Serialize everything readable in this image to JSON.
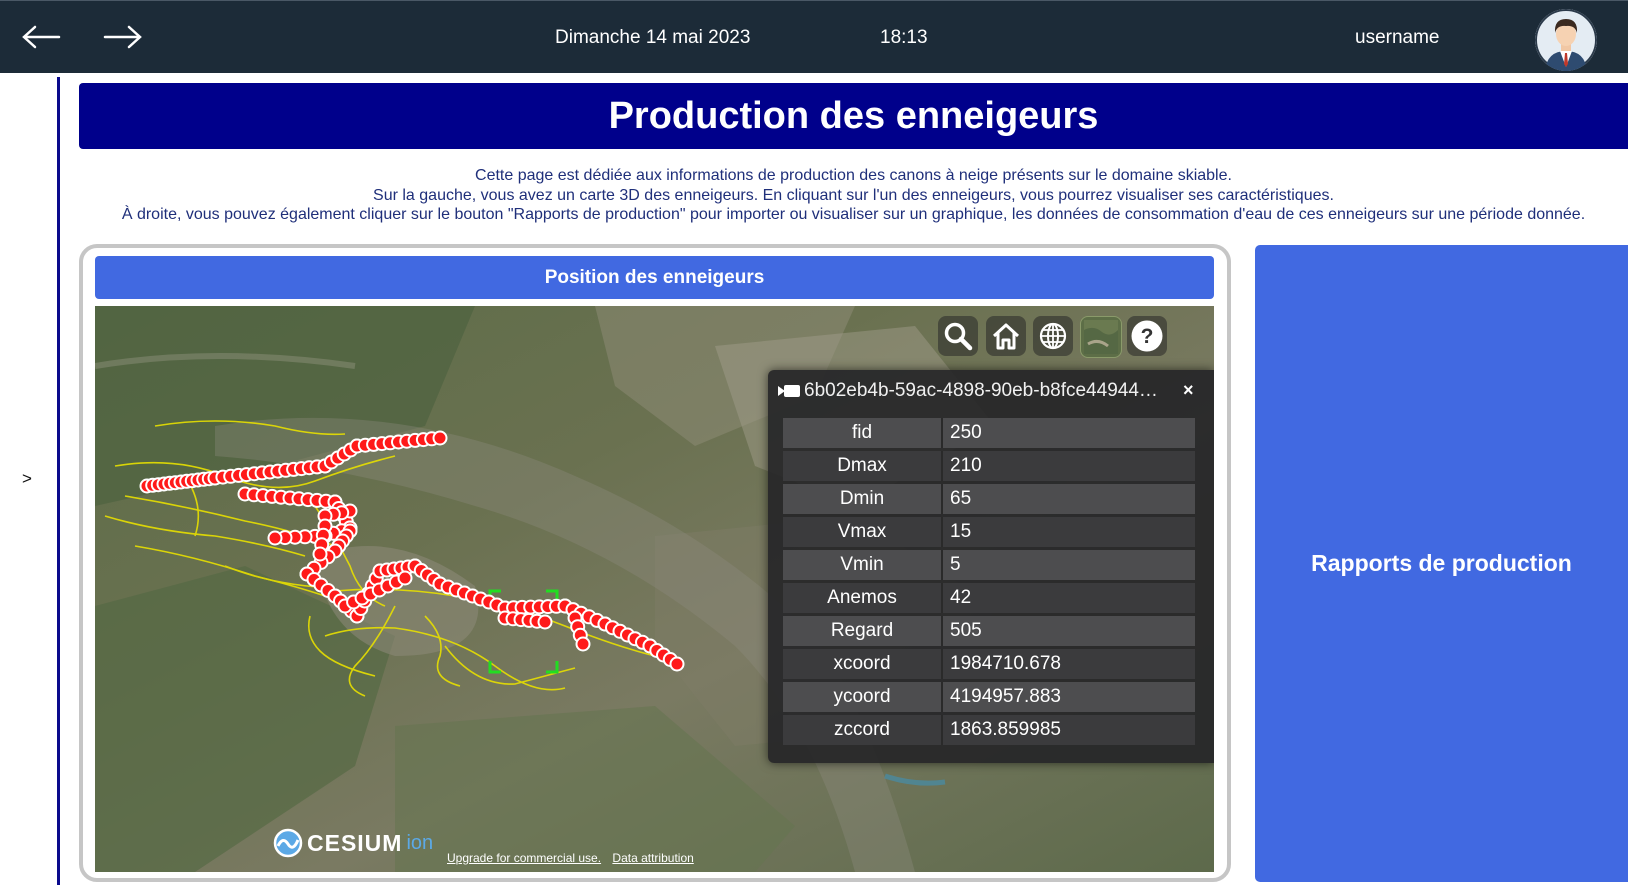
{
  "topbar": {
    "date": "Dimanche 14 mai 2023",
    "time": "18:13",
    "username": "username"
  },
  "sidepanel": {
    "toggle_label": ">"
  },
  "page": {
    "title": "Production des enneigeurs",
    "intro": [
      "Cette page est dédiée aux informations de production des canons à neige présents sur le domaine skiable.",
      "Sur la gauche, vous avez un carte 3D des enneigeurs. En cliquant sur l'un des enneigeurs, vous pourrez visualiser ses caractéristiques.",
      "À droite, vous pouvez également cliquer sur le bouton \"Rapports de production\" pour importer ou visualiser sur un graphique, les données de consommation d'eau de ces enneigeurs sur une période donnée."
    ]
  },
  "map": {
    "header": "Position des enneigeurs",
    "infobox": {
      "title": "6b02eb4b-59ac-4898-90eb-b8fce44944…",
      "close": "×",
      "rows": [
        {
          "key": "fid",
          "value": "250"
        },
        {
          "key": "Dmax",
          "value": "210"
        },
        {
          "key": "Dmin",
          "value": "65"
        },
        {
          "key": "Vmax",
          "value": "15"
        },
        {
          "key": "Vmin",
          "value": "5"
        },
        {
          "key": "Anemos",
          "value": "42"
        },
        {
          "key": "Regard",
          "value": "505"
        },
        {
          "key": "xcoord",
          "value": "1984710.678"
        },
        {
          "key": "ycoord",
          "value": "4194957.883"
        },
        {
          "key": "zccord",
          "value": "1863.859985"
        }
      ]
    },
    "toolbar_icons": [
      "search-icon",
      "home-icon",
      "globe-icon",
      "base-layer-picker-icon",
      "help-icon"
    ],
    "logo": {
      "word": "CESIUM",
      "suffix": "ion"
    },
    "credits": {
      "upgrade": "Upgrade for commercial use.",
      "attribution": "Data attribution"
    },
    "colors": {
      "marker": "#ff1a1a",
      "trail": "#e8e000",
      "selection": "#22dd22"
    }
  },
  "report_button": {
    "label": "Rapports de production"
  }
}
